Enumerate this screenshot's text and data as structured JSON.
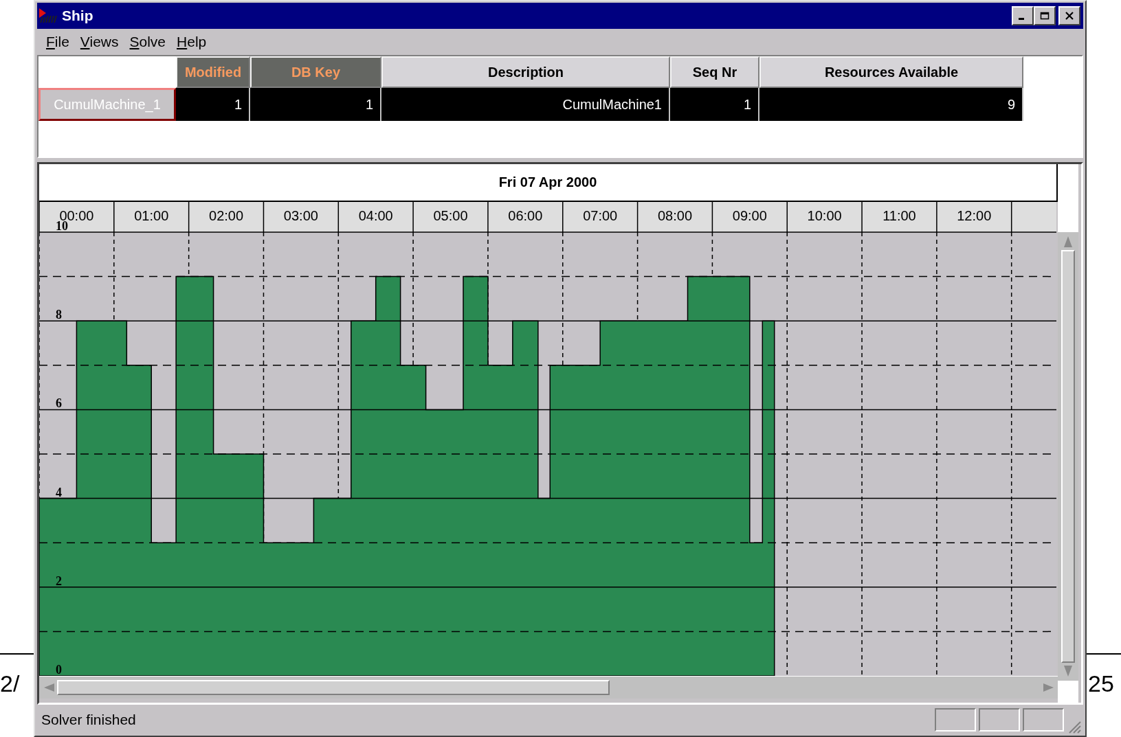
{
  "window": {
    "title": "Ship"
  },
  "menu": [
    "File",
    "Views",
    "Solve",
    "Help"
  ],
  "table": {
    "columns": [
      {
        "label": "Modified",
        "kind": "highlighted"
      },
      {
        "label": "DB Key",
        "kind": "highlighted"
      },
      {
        "label": "Description",
        "kind": "normal"
      },
      {
        "label": "Seq Nr",
        "kind": "normal"
      },
      {
        "label": "Resources Available",
        "kind": "normal"
      }
    ],
    "rows": [
      {
        "header": "CumulMachine_1",
        "selected": true,
        "cells": [
          "1",
          "1",
          "CumulMachine1",
          "1",
          "9"
        ]
      }
    ]
  },
  "schedule": {
    "date": "Fri 07 Apr 2000",
    "chart_data": {
      "type": "area",
      "grid": true,
      "x": [
        -0.5,
        0,
        0.67,
        1,
        1.33,
        1.83,
        2.5,
        3.17,
        3.67,
        4,
        4.33,
        4.67,
        5.17,
        5.5,
        5.83,
        6.17,
        6.33,
        7,
        8.17,
        9,
        9.17,
        9.33
      ],
      "series": [
        {
          "color": "#2a8a52",
          "values": [
            4,
            8,
            7,
            3,
            9,
            5,
            3,
            4,
            8,
            9,
            7,
            6,
            9,
            7,
            8,
            4,
            7,
            8,
            9,
            3,
            8,
            0
          ]
        }
      ],
      "xlim": [
        -0.5,
        13.1
      ],
      "ylim": [
        0,
        10
      ],
      "xticks": [
        {
          "value": 0,
          "label": "00:00"
        },
        {
          "value": 1,
          "label": "01:00"
        },
        {
          "value": 2,
          "label": "02:00"
        },
        {
          "value": 3,
          "label": "03:00"
        },
        {
          "value": 4,
          "label": "04:00"
        },
        {
          "value": 5,
          "label": "05:00"
        },
        {
          "value": 6,
          "label": "06:00"
        },
        {
          "value": 7,
          "label": "07:00"
        },
        {
          "value": 8,
          "label": "08:00"
        },
        {
          "value": 9,
          "label": "09:00"
        },
        {
          "value": 10,
          "label": "10:00"
        },
        {
          "value": 11,
          "label": "11:00"
        },
        {
          "value": 12,
          "label": "12:00"
        }
      ],
      "yticks": [
        0,
        2,
        4,
        6,
        8,
        10
      ]
    }
  },
  "status_bar": {
    "message": "Solver finished"
  },
  "background_page": {
    "left_text": "2/",
    "right_text": "25"
  }
}
